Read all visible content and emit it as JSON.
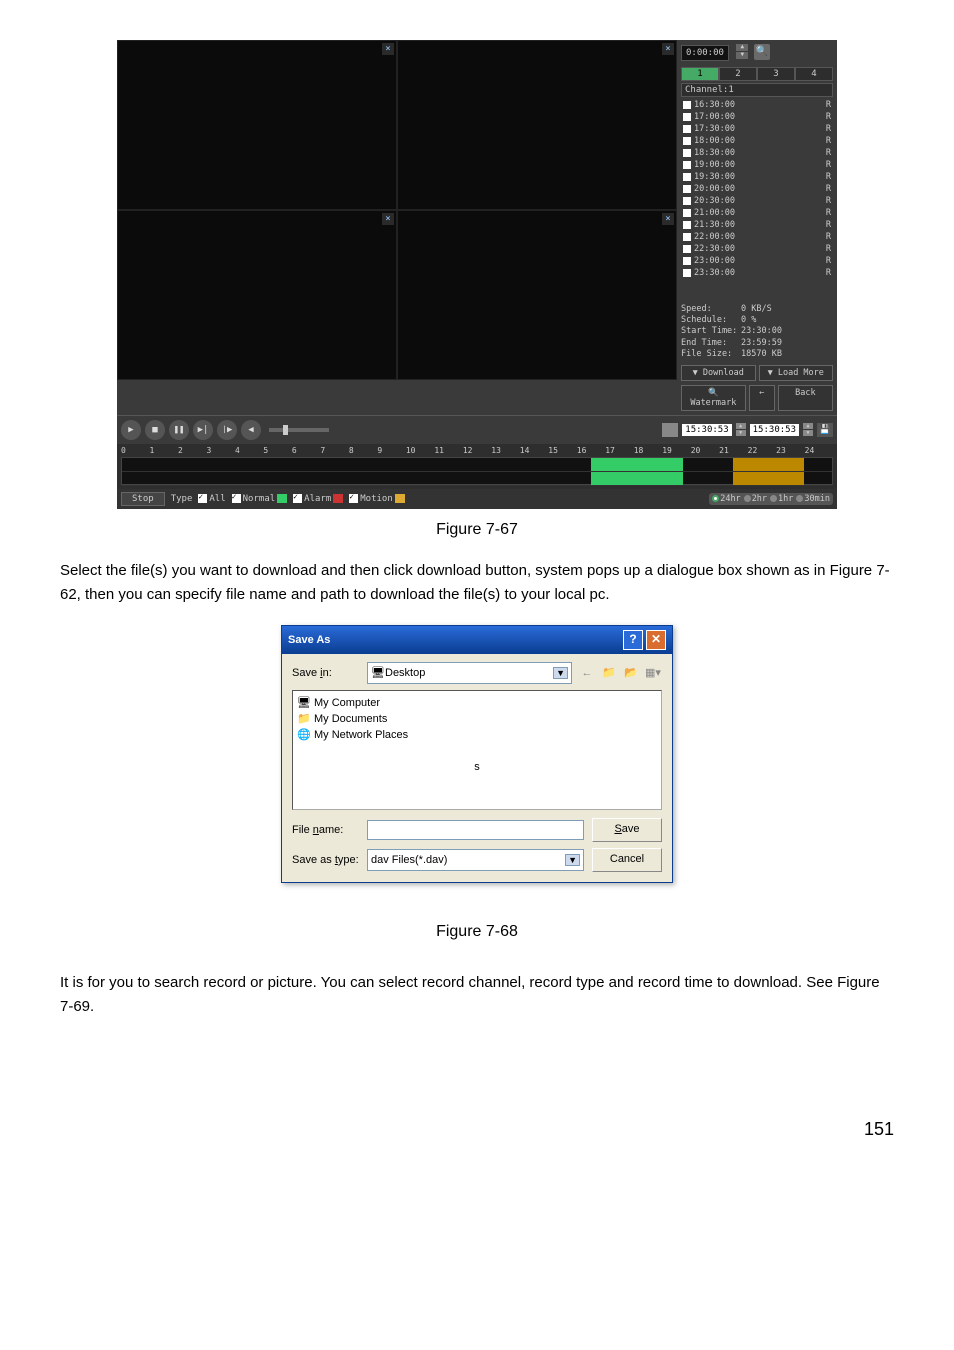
{
  "playback": {
    "time_display": "0:00:00",
    "channel_tabs": [
      "1",
      "2",
      "3",
      "4"
    ],
    "channel_label": "Channel:1",
    "files": [
      {
        "t": "16:30:00",
        "r": "R"
      },
      {
        "t": "17:00:00",
        "r": "R"
      },
      {
        "t": "17:30:00",
        "r": "R"
      },
      {
        "t": "18:00:00",
        "r": "R"
      },
      {
        "t": "18:30:00",
        "r": "R"
      },
      {
        "t": "19:00:00",
        "r": "R"
      },
      {
        "t": "19:30:00",
        "r": "R"
      },
      {
        "t": "20:00:00",
        "r": "R"
      },
      {
        "t": "20:30:00",
        "r": "R"
      },
      {
        "t": "21:00:00",
        "r": "R"
      },
      {
        "t": "21:30:00",
        "r": "R"
      },
      {
        "t": "22:00:00",
        "r": "R"
      },
      {
        "t": "22:30:00",
        "r": "R"
      },
      {
        "t": "23:00:00",
        "r": "R"
      },
      {
        "t": "23:30:00",
        "r": "R"
      }
    ],
    "meta": {
      "speed_label": "Speed:",
      "speed": "0 KB/S",
      "schedule_label": "Schedule:",
      "schedule": "0 %",
      "start_label": "Start Time:",
      "start": "23:30:00",
      "end_label": "End Time:",
      "end": "23:59:59",
      "size_label": "File Size:",
      "size": "18570 KB"
    },
    "download_btn": "Download",
    "loadmore_btn": "Load More",
    "watermark_btn": "Watermark",
    "back_btn": "Back",
    "arrow_btn": "←",
    "time1": "15:30:53",
    "time2": "15:30:53",
    "timeline_hours": [
      "0",
      "1",
      "2",
      "3",
      "4",
      "5",
      "6",
      "7",
      "8",
      "9",
      "10",
      "11",
      "12",
      "13",
      "14",
      "15",
      "16",
      "17",
      "18",
      "19",
      "20",
      "21",
      "22",
      "23",
      "24"
    ],
    "stop": "Stop",
    "type_label": "Type",
    "all": "All",
    "normal": "Normal",
    "alarm": "Alarm",
    "motion": "Motion",
    "zoom": [
      "24hr",
      "2hr",
      "1hr",
      "30min"
    ]
  },
  "caption1": "Figure 7-67",
  "para1": "Select the file(s) you want to download and then click download button, system pops up a dialogue box shown as in Figure 7-62, then you can specify file name and path to download the file(s) to your local pc.",
  "saveas": {
    "title": "Save As",
    "savein_label": "Save in:",
    "savein_value": "Desktop",
    "items": [
      "My Computer",
      "My Documents",
      "My Network Places"
    ],
    "stray": "s",
    "filename_label": "File name:",
    "filename_value": "",
    "saveas_type_label": "Save as type:",
    "saveas_type_value": "dav Files(*.dav)",
    "save_btn": "Save",
    "cancel_btn": "Cancel"
  },
  "caption2": "Figure 7-68",
  "para2": "It is for you to search record or picture. You can select record channel, record type and record time to download. See Figure 7-69.",
  "page_number": "151"
}
